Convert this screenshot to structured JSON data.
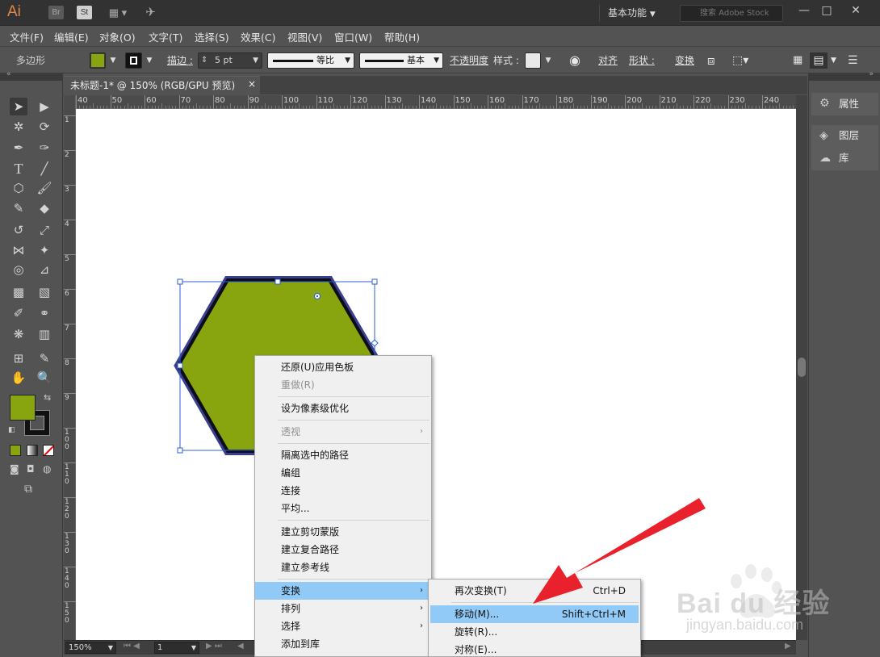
{
  "app": {
    "logo": "Ai",
    "bridge": "Br",
    "stock": "St",
    "workspace": "基本功能",
    "search_placeholder": "搜索 Adobe Stock"
  },
  "menubar": [
    "文件(F)",
    "编辑(E)",
    "对象(O)",
    "文字(T)",
    "选择(S)",
    "效果(C)",
    "视图(V)",
    "窗口(W)",
    "帮助(H)"
  ],
  "control": {
    "object_type": "多边形",
    "fill_color": "#88a40f",
    "stroke_label": "描边 :",
    "stroke_value": "5 pt",
    "profile_label": "等比",
    "brush_label": "基本",
    "opacity_label": "不透明度",
    "style_label": "样式 :",
    "align_label": "对齐",
    "shape_label": "形状 :",
    "transform_label": "变换"
  },
  "document": {
    "tab_title": "未标题-1* @ 150% (RGB/GPU 预览)",
    "close": "×",
    "zoom": "150%",
    "page": "1"
  },
  "ruler": {
    "top": [
      "40",
      "50",
      "60",
      "70",
      "80",
      "90",
      "100",
      "110",
      "120",
      "130",
      "140",
      "150",
      "160",
      "170",
      "180",
      "190",
      "200",
      "210",
      "220",
      "230",
      "240"
    ],
    "left": [
      "1",
      "2",
      "3",
      "4",
      "5",
      "6",
      "7",
      "8",
      "9",
      "1\n0\n0",
      "1\n1\n0",
      "1\n2\n0",
      "1\n3\n0",
      "1\n4\n0",
      "1\n5\n0"
    ]
  },
  "shape": {
    "fill": "#88a40f",
    "stroke": "#0d0d1a",
    "outline": "#3a3f8f",
    "bbox_color": "#2c5fd6"
  },
  "right_panel": {
    "properties": "属性",
    "layers": "图层",
    "libraries": "库"
  },
  "context_menu": {
    "items": [
      {
        "label": "还原(U)应用色板",
        "disabled": false
      },
      {
        "label": "重做(R)",
        "disabled": true
      },
      {
        "label": "设为像素级优化",
        "disabled": false
      },
      {
        "label": "透视",
        "disabled": true,
        "submenu": true
      },
      {
        "label": "隔离选中的路径",
        "disabled": false
      },
      {
        "label": "编组",
        "disabled": false
      },
      {
        "label": "连接",
        "disabled": false
      },
      {
        "label": "平均...",
        "disabled": false
      },
      {
        "label": "建立剪切蒙版",
        "disabled": false
      },
      {
        "label": "建立复合路径",
        "disabled": false
      },
      {
        "label": "建立参考线",
        "disabled": false
      },
      {
        "label": "变换",
        "disabled": false,
        "submenu": true,
        "highlighted": true
      },
      {
        "label": "排列",
        "disabled": false,
        "submenu": true
      },
      {
        "label": "选择",
        "disabled": false,
        "submenu": true
      },
      {
        "label": "添加到库",
        "disabled": false
      }
    ]
  },
  "submenu": {
    "items": [
      {
        "label": "再次变换(T)",
        "shortcut": "Ctrl+D"
      },
      {
        "label": "移动(M)...",
        "shortcut": "Shift+Ctrl+M",
        "highlighted": true
      },
      {
        "label": "旋转(R)...",
        "shortcut": ""
      },
      {
        "label": "对称(E)...",
        "shortcut": ""
      }
    ]
  },
  "watermark": {
    "brand": "Bai du 经验",
    "url": "jingyan.baidu.com"
  },
  "annotation": {
    "arrow_color": "#e8212c"
  }
}
